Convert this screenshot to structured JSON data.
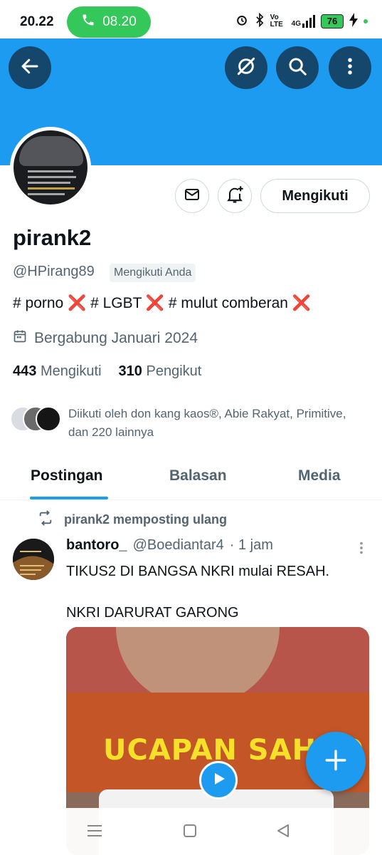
{
  "status_bar": {
    "time": "20.22",
    "call_duration": "08.20",
    "network": "Vo LTE",
    "signal": "4G",
    "battery": "76"
  },
  "header": {
    "back_icon": "arrow-left-icon",
    "grok_icon": "slash-circle-icon",
    "search_icon": "search-icon",
    "more_icon": "more-vertical-icon"
  },
  "profile": {
    "name": "pirank2",
    "handle": "@HPirang89",
    "follows_you_badge": "Mengikuti Anda",
    "bio_parts": [
      "# porno",
      "❌",
      "# LGBT",
      "❌",
      "# mulut comberan",
      "❌"
    ],
    "joined": "Bergabung Januari 2024",
    "following_count": "443",
    "following_label": "Mengikuti",
    "followers_count": "310",
    "followers_label": "Pengikut",
    "followed_by": "Diikuti oleh don kang kaos®, Abie Rakyat, Primitive, dan 220 lainnya",
    "follow_button": "Mengikuti"
  },
  "tabs": [
    {
      "label": "Postingan",
      "active": true
    },
    {
      "label": "Balasan",
      "active": false
    },
    {
      "label": "Media",
      "active": false
    }
  ],
  "post": {
    "repost_label": "pirank2 memposting ulang",
    "author_name": "bantoro_",
    "author_handle": "@Boediantar4",
    "time": "· 1 jam",
    "text": "TIKUS2 DI BANGSA NKRI mulai RESAH.\n\nNKRI DARURAT GARONG",
    "media_caption": "UCAPAN SAHRO"
  },
  "colors": {
    "accent": "#1d9bf0",
    "header_button": "#14476b",
    "call_pill": "#34c759"
  }
}
